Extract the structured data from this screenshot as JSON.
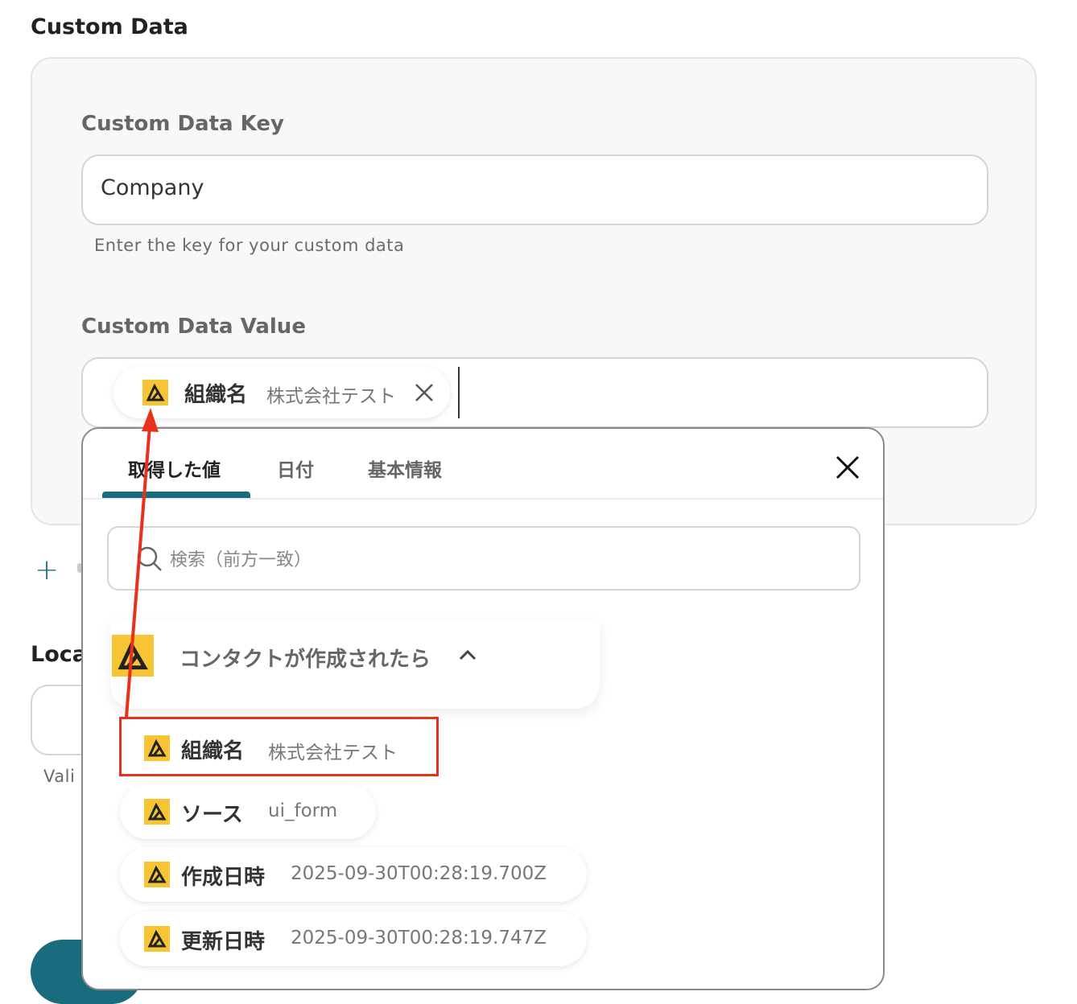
{
  "section": {
    "title": "Custom Data"
  },
  "key_field": {
    "label": "Custom Data Key",
    "value": "Company",
    "hint": "Enter the key for your custom data"
  },
  "value_field": {
    "label": "Custom Data Value",
    "chip": {
      "name": "組織名",
      "value": "株式会社テスト"
    }
  },
  "add_button": {
    "label": "+"
  },
  "below": {
    "title_partial": "Loca",
    "hint_partial": "Vali"
  },
  "popup": {
    "tabs": [
      {
        "label": "取得した値",
        "active": true
      },
      {
        "label": "日付",
        "active": false
      },
      {
        "label": "基本情報",
        "active": false
      }
    ],
    "search_placeholder": "検索（前方一致）",
    "group": {
      "title": "コンタクトが作成されたら",
      "items": [
        {
          "name": "組織名",
          "value": "株式会社テスト",
          "highlighted": true
        },
        {
          "name": "ソース",
          "value": "ui_form"
        },
        {
          "name": "作成日時",
          "value": "2025-09-30T00:28:19.700Z"
        },
        {
          "name": "更新日時",
          "value": "2025-09-30T00:28:19.747Z"
        }
      ]
    }
  },
  "colors": {
    "accent": "#1a6b7d",
    "icon_yellow": "#f7c534",
    "highlight_red": "#e8301c"
  },
  "icons": [
    "app-logo-icon",
    "close-icon",
    "search-icon",
    "chevron-up-icon",
    "plus-icon"
  ]
}
